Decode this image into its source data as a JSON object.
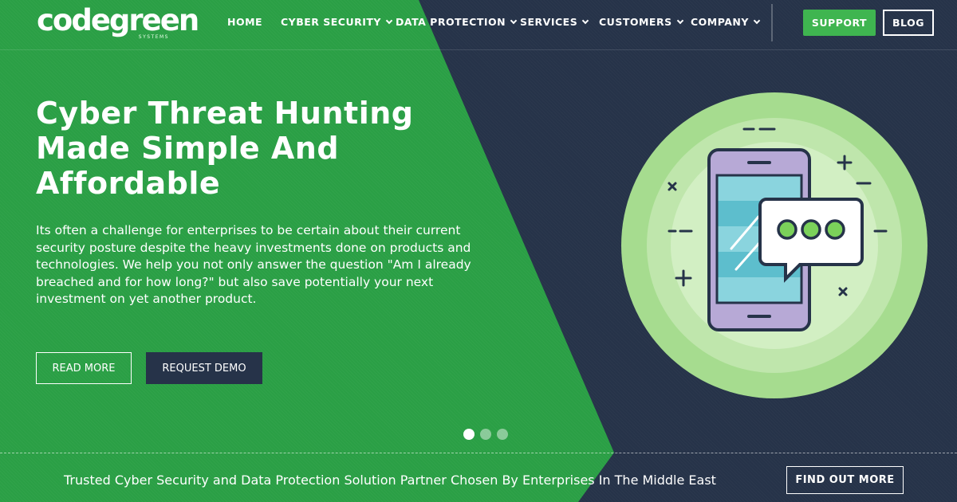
{
  "brand": {
    "name": "codegreen",
    "tagline": "SYSTEMS"
  },
  "nav": {
    "items": [
      {
        "label": "HOME",
        "dropdown": false
      },
      {
        "label": "CYBER SECURITY",
        "dropdown": true
      },
      {
        "label": "DATA PROTECTION",
        "dropdown": true
      },
      {
        "label": "SERVICES",
        "dropdown": true
      },
      {
        "label": "CUSTOMERS",
        "dropdown": true
      },
      {
        "label": "COMPANY",
        "dropdown": true
      }
    ],
    "support_label": "SUPPORT",
    "blog_label": "BLOG"
  },
  "hero": {
    "title_line1": "Cyber Threat Hunting",
    "title_line2": "Made Simple And",
    "title_line3": "Affordable",
    "text": "Its often a challenge for enterprises to be certain about their current security posture despite the heavy investments done on products and technologies. We help you not only answer the question \"Am I already breached and for how long?\" but also save potentially your next investment on yet another product.",
    "read_more_label": "READ MORE",
    "request_demo_label": "REQUEST DEMO"
  },
  "slider": {
    "slide_count": 3,
    "active_slide": 1
  },
  "footer": {
    "trusted_text": "Trusted Cyber Security and Data Protection Solution Partner Chosen By Enterprises In The Middle East",
    "find_out_label": "FIND OUT MORE"
  },
  "colors": {
    "green": "#2a9f45",
    "navy": "#263349",
    "support_green": "#3fb550",
    "circle_light": "#a6dc8f"
  },
  "illustration": {
    "icon": "smartphone-chat-icon"
  }
}
